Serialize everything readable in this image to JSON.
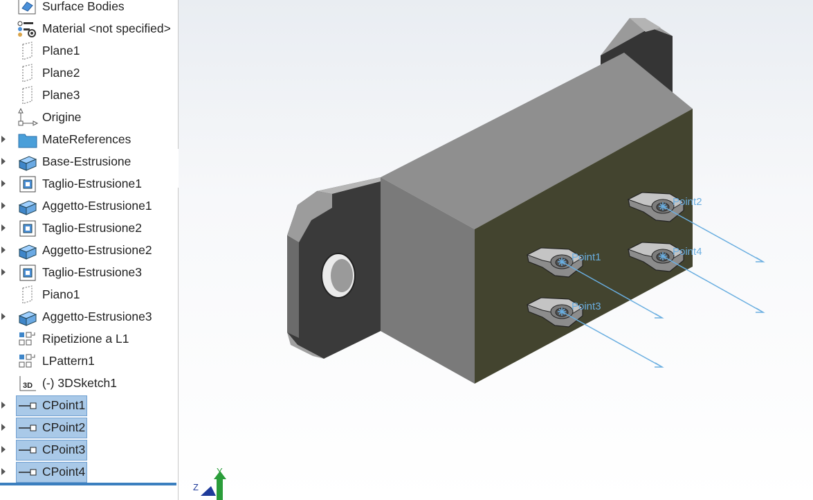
{
  "tree": {
    "items": [
      {
        "label": "Surface Bodies",
        "icon": "surface-bodies-icon",
        "arrow": false,
        "selected": false
      },
      {
        "label": "Material <not specified>",
        "icon": "material-icon",
        "arrow": false,
        "selected": false
      },
      {
        "label": "Plane1",
        "icon": "plane-icon",
        "arrow": false,
        "selected": false
      },
      {
        "label": "Plane2",
        "icon": "plane-icon",
        "arrow": false,
        "selected": false
      },
      {
        "label": "Plane3",
        "icon": "plane-icon",
        "arrow": false,
        "selected": false
      },
      {
        "label": "Origine",
        "icon": "origin-icon",
        "arrow": false,
        "selected": false
      },
      {
        "label": "MateReferences",
        "icon": "folder-icon",
        "arrow": true,
        "selected": false
      },
      {
        "label": "Base-Estrusione",
        "icon": "boss-extrude-icon",
        "arrow": true,
        "selected": false
      },
      {
        "label": "Taglio-Estrusione1",
        "icon": "cut-extrude-icon",
        "arrow": true,
        "selected": false
      },
      {
        "label": "Aggetto-Estrusione1",
        "icon": "boss-extrude-icon",
        "arrow": true,
        "selected": false
      },
      {
        "label": "Taglio-Estrusione2",
        "icon": "cut-extrude-icon",
        "arrow": true,
        "selected": false
      },
      {
        "label": "Aggetto-Estrusione2",
        "icon": "boss-extrude-icon",
        "arrow": true,
        "selected": false
      },
      {
        "label": "Taglio-Estrusione3",
        "icon": "cut-extrude-icon",
        "arrow": true,
        "selected": false
      },
      {
        "label": "Piano1",
        "icon": "plane-icon",
        "arrow": false,
        "selected": false
      },
      {
        "label": "Aggetto-Estrusione3",
        "icon": "boss-extrude-icon",
        "arrow": true,
        "selected": false
      },
      {
        "label": "Ripetizione a L1",
        "icon": "linear-pattern-icon",
        "arrow": false,
        "selected": false
      },
      {
        "label": "LPattern1",
        "icon": "linear-pattern-icon",
        "arrow": false,
        "selected": false
      },
      {
        "label": "(-) 3DSketch1",
        "icon": "sketch-3d-icon",
        "arrow": false,
        "selected": false
      },
      {
        "label": "CPoint1",
        "icon": "connection-point-icon",
        "arrow": true,
        "selected": true
      },
      {
        "label": "CPoint2",
        "icon": "connection-point-icon",
        "arrow": true,
        "selected": true
      },
      {
        "label": "CPoint3",
        "icon": "connection-point-icon",
        "arrow": true,
        "selected": true
      },
      {
        "label": "CPoint4",
        "icon": "connection-point-icon",
        "arrow": true,
        "selected": true
      }
    ]
  },
  "viewport": {
    "points": [
      {
        "label": "Point1"
      },
      {
        "label": "Point2"
      },
      {
        "label": "Point3"
      },
      {
        "label": "Point4"
      }
    ],
    "triad": {
      "y_label": "Y",
      "z_label": "Z"
    }
  },
  "colors": {
    "selection_fill": "#a9c9e8",
    "selection_border": "#6f9fd0",
    "point_blue": "#6aaee0",
    "part_gray": "#8f8f8f",
    "front_face_olive": "#43442f"
  }
}
